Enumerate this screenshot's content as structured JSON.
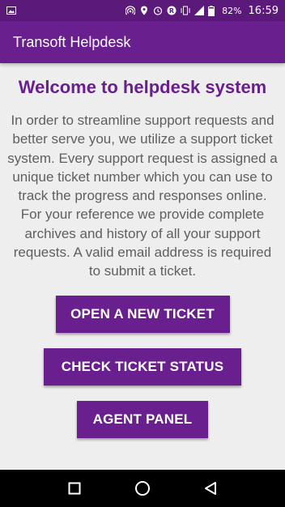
{
  "status_bar": {
    "battery": "82%",
    "time": "16:59",
    "icons": [
      "image-icon",
      "hotspot-icon",
      "location-icon",
      "alarm-icon",
      "roaming-icon",
      "vibrate-icon",
      "signal-icon",
      "battery-icon"
    ]
  },
  "app_bar": {
    "title": "Transoft Helpdesk"
  },
  "main": {
    "heading": "Welcome to helpdesk system",
    "intro": "In order to streamline support requests and better serve you, we utilize a support ticket system. Every support request is assigned a unique ticket number which you can use to track the progress and responses online. For your reference we provide complete archives and history of all your support requests. A valid email address is required to submit a ticket.",
    "buttons": {
      "open_ticket": "OPEN A NEW TICKET",
      "check_status": "CHECK TICKET STATUS",
      "agent_panel": "AGENT PANEL"
    }
  },
  "nav_bar": {
    "icons": [
      "recents-icon",
      "home-icon",
      "back-icon"
    ]
  },
  "colors": {
    "primary": "#6a1f8f",
    "primary_dark": "#5b1a7a",
    "background": "#eeeeee",
    "body_text": "#5f5f5f"
  }
}
